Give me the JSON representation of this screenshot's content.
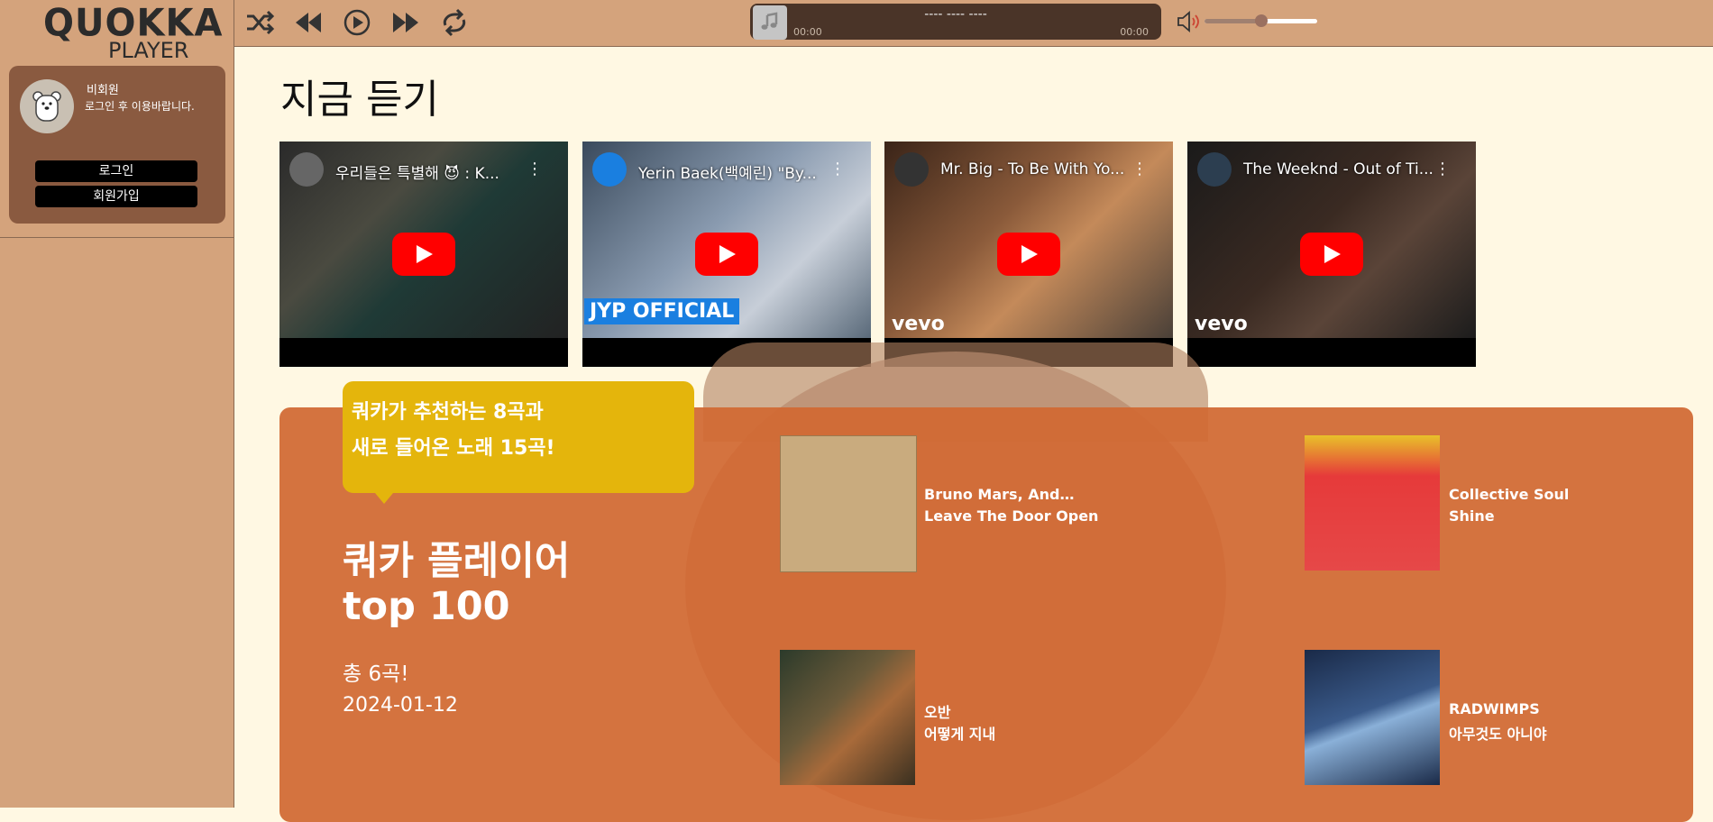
{
  "sidebar": {
    "logo_line1": "QUOKKA",
    "logo_line2": "PLAYER",
    "user_name": "비회원",
    "user_note": "로그인 후 이용바랍니다.",
    "login_label": "로그인",
    "signup_label": "회원가입"
  },
  "player": {
    "now_playing_title": "---- ---- ----",
    "time_elapsed": "00:00",
    "time_total": "00:00",
    "volume": 0.5,
    "icons": [
      "shuffle-icon",
      "previous-icon",
      "play-icon",
      "next-icon",
      "repeat-icon",
      "volume-icon"
    ]
  },
  "main": {
    "page_title": "지금 듣기",
    "videos": [
      {
        "title": "우리들은 특별해 😈 : K...",
        "watermark": ""
      },
      {
        "title": "Yerin Baek(백예린) \"By...",
        "watermark": "JYP OFFICIAL"
      },
      {
        "title": "Mr. Big - To Be With Yo...",
        "watermark": "vevo"
      },
      {
        "title": "The Weeknd - Out of Ti...",
        "watermark": "vevo"
      }
    ],
    "top100": {
      "bubble_line1": "쿼카가 추천하는 8곡과",
      "bubble_line2": "새로 들어온 노래 15곡!",
      "title_line1": "쿼카 플레이어",
      "title_line2": "top 100",
      "count": "총 6곡!",
      "date": "2024-01-12",
      "songs": [
        {
          "artist": "Bruno Mars, Anderso...",
          "title": "Leave The Door Open"
        },
        {
          "artist": "Collective Soul",
          "title": "Shine"
        },
        {
          "artist": "오반",
          "title": "어떻게 지내"
        },
        {
          "artist": "RADWIMPS",
          "title": "아무것도 아니야"
        }
      ]
    }
  },
  "colors": {
    "sidebar": "#d4a37c",
    "card": "#8a5a40",
    "background": "#fff8e3",
    "top100": "#d16833",
    "bubble": "#e4b50c"
  }
}
